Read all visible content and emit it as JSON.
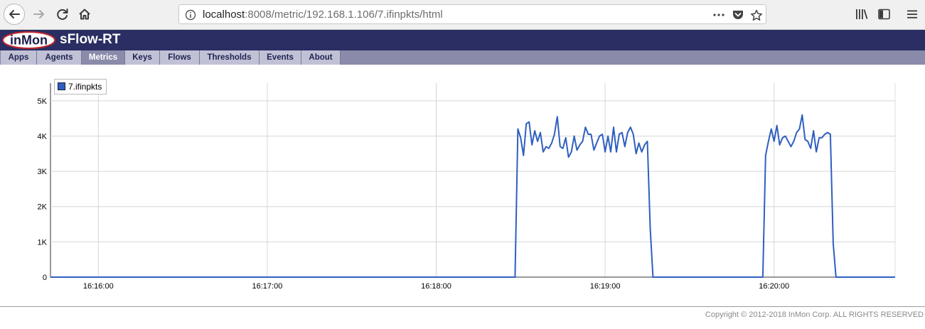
{
  "browser": {
    "url_host": "localhost",
    "url_rest": ":8008/metric/192.168.1.106/7.ifinpkts/html"
  },
  "app": {
    "logo_text": "inMon",
    "title": "sFlow-RT",
    "tabs": [
      {
        "label": "Apps",
        "active": false
      },
      {
        "label": "Agents",
        "active": false
      },
      {
        "label": "Metrics",
        "active": true
      },
      {
        "label": "Keys",
        "active": false
      },
      {
        "label": "Flows",
        "active": false
      },
      {
        "label": "Thresholds",
        "active": false
      },
      {
        "label": "Events",
        "active": false
      },
      {
        "label": "About",
        "active": false
      }
    ]
  },
  "chart_data": {
    "type": "line",
    "legend": [
      "7.ifinpkts"
    ],
    "series_color": "#2f5fbf",
    "y_ticks": [
      "0",
      "1K",
      "2K",
      "3K",
      "4K",
      "5K"
    ],
    "y_tick_values": [
      0,
      1000,
      2000,
      3000,
      4000,
      5000
    ],
    "x_ticks": [
      "16:16:00",
      "16:17:00",
      "16:18:00",
      "16:19:00",
      "16:20:00"
    ],
    "x_tick_seconds": [
      0,
      60,
      120,
      180,
      240
    ],
    "grid": true,
    "legend_placement": "top-left",
    "x_start_seconds": -17,
    "x_end_seconds": 283,
    "ylim": [
      0,
      5500
    ],
    "series": [
      {
        "name": "7.ifinpkts",
        "points": [
          [
            -17,
            0
          ],
          [
            148,
            0
          ],
          [
            149,
            4200
          ],
          [
            150,
            3950
          ],
          [
            151,
            3450
          ],
          [
            152,
            4350
          ],
          [
            153,
            4400
          ],
          [
            154,
            3750
          ],
          [
            155,
            4150
          ],
          [
            156,
            3850
          ],
          [
            157,
            4100
          ],
          [
            158,
            3550
          ],
          [
            159,
            3700
          ],
          [
            160,
            3650
          ],
          [
            161,
            3800
          ],
          [
            162,
            4050
          ],
          [
            163,
            4550
          ],
          [
            164,
            3700
          ],
          [
            165,
            3650
          ],
          [
            166,
            3950
          ],
          [
            167,
            3400
          ],
          [
            168,
            3550
          ],
          [
            169,
            4000
          ],
          [
            170,
            3600
          ],
          [
            171,
            3750
          ],
          [
            172,
            3850
          ],
          [
            173,
            4250
          ],
          [
            174,
            4050
          ],
          [
            175,
            4050
          ],
          [
            176,
            3600
          ],
          [
            177,
            3800
          ],
          [
            178,
            4000
          ],
          [
            179,
            4050
          ],
          [
            180,
            3550
          ],
          [
            181,
            4000
          ],
          [
            182,
            3550
          ],
          [
            183,
            4250
          ],
          [
            184,
            3550
          ],
          [
            185,
            4050
          ],
          [
            186,
            4100
          ],
          [
            187,
            3700
          ],
          [
            188,
            4100
          ],
          [
            189,
            4250
          ],
          [
            190,
            4050
          ],
          [
            191,
            3500
          ],
          [
            192,
            3800
          ],
          [
            193,
            3550
          ],
          [
            194,
            3750
          ],
          [
            195,
            3850
          ],
          [
            196,
            1400
          ],
          [
            197,
            0
          ],
          [
            236,
            0
          ],
          [
            237,
            3450
          ],
          [
            238,
            3850
          ],
          [
            239,
            4200
          ],
          [
            240,
            3850
          ],
          [
            241,
            4300
          ],
          [
            242,
            3750
          ],
          [
            243,
            3950
          ],
          [
            244,
            4000
          ],
          [
            245,
            3850
          ],
          [
            246,
            3700
          ],
          [
            247,
            3850
          ],
          [
            248,
            4100
          ],
          [
            249,
            4200
          ],
          [
            250,
            4600
          ],
          [
            251,
            3900
          ],
          [
            252,
            3850
          ],
          [
            253,
            3650
          ],
          [
            254,
            4150
          ],
          [
            255,
            3550
          ],
          [
            256,
            3950
          ],
          [
            257,
            3950
          ],
          [
            258,
            4050
          ],
          [
            259,
            4100
          ],
          [
            260,
            4050
          ],
          [
            261,
            950
          ],
          [
            262,
            0
          ],
          [
            283,
            0
          ]
        ]
      }
    ]
  },
  "footer": {
    "copyright": "Copyright © 2012-2018 InMon Corp. ALL RIGHTS RESERVED"
  },
  "icons": [
    "back-icon",
    "forward-icon",
    "reload-icon",
    "home-icon",
    "info-icon",
    "more-icon",
    "pocket-icon",
    "bookmark-star-icon",
    "library-icon",
    "sidebar-icon",
    "menu-icon"
  ]
}
